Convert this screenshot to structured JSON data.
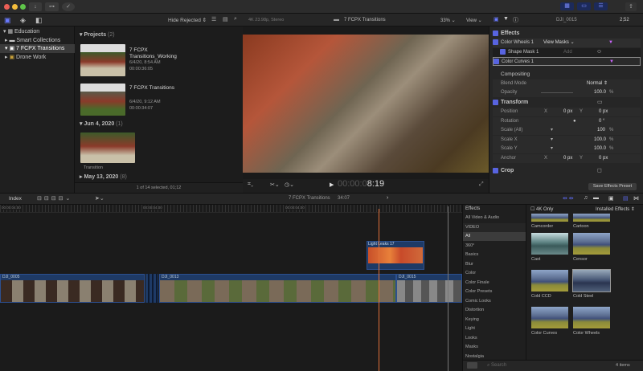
{
  "toolbar": {
    "import": "↓",
    "keywords": "⊶",
    "bg_tasks": "✓"
  },
  "browser_header": {
    "filter": "Hide Rejected"
  },
  "sidebar": {
    "items": [
      {
        "label": "Education",
        "icon": "library-icon"
      },
      {
        "label": "Smart Collections",
        "icon": "folder-icon"
      },
      {
        "label": "7 FCPX Transitions",
        "icon": "event-icon"
      },
      {
        "label": "Drone Work",
        "icon": "event-icon"
      }
    ]
  },
  "browser": {
    "projects_heading": "Projects",
    "projects_count": "(2)",
    "projects": [
      {
        "title": "7 FCPX Transitions_Working",
        "date": "6/4/20, 8:54 AM",
        "duration": "00:00:36:05"
      },
      {
        "title": "7 FCPX Transitions",
        "date": "6/4/20, 9:12 AM",
        "duration": "00:00:34:07"
      }
    ],
    "group1": "Jun 4, 2020",
    "group1_count": "(1)",
    "clip_label": "Transition",
    "group2": "May 13, 2020",
    "group2_count": "(8)",
    "status": "1 of 14 selected, 01;12"
  },
  "viewer": {
    "format": "4K 23.98p, Stereo",
    "title": "7 FCPX Transitions",
    "zoom": "33%",
    "view": "View",
    "timecode_dim": "00:00:0",
    "timecode": "8:19"
  },
  "inspector": {
    "clip": "DJI_0015",
    "timecode": "2;52",
    "effects_heading": "Effects",
    "color_wheels": "Color Wheels 1",
    "view_masks": "View Masks",
    "shape_mask": "Shape Mask 1",
    "add": "Add",
    "color_curves": "Color Curves 1",
    "compositing": "Compositing",
    "blend_mode": "Blend Mode",
    "blend_value": "Normal",
    "opacity": "Opacity",
    "opacity_value": "100.0",
    "pct": "%",
    "transform": "Transform",
    "position": "Position",
    "rotation": "Rotation",
    "rotation_value": "0 °",
    "scale_all": "Scale (All)",
    "scale_all_value": "100",
    "scale_x": "Scale X",
    "scale_x_value": "100.0",
    "scale_y": "Scale Y",
    "scale_y_value": "100.0",
    "anchor": "Anchor",
    "x": "X",
    "y": "Y",
    "zero_px": "0 px",
    "crop": "Crop",
    "save_preset": "Save Effects Preset"
  },
  "timeline": {
    "index": "Index",
    "project": "7 FCPX Transitions",
    "duration": "34:07",
    "ruler": [
      "00:00:04:00",
      "00:00:04:00",
      "00:00:04:00"
    ],
    "clips": [
      {
        "name": "DJI_0005"
      },
      {
        "name": "DJI_0013"
      },
      {
        "name": "DJI_0015"
      }
    ],
    "connected_clip": "Light Leaks 17"
  },
  "effects_browser": {
    "heading": "Effects",
    "four_k": "4K Only",
    "installed": "Installed Effects",
    "categories": [
      "All Video & Audio",
      "VIDEO",
      "All",
      "360°",
      "Basics",
      "Blur",
      "Color",
      "Color Finale",
      "Color Presets",
      "Comic Looks",
      "Distortion",
      "Keying",
      "Light",
      "Looks",
      "Masks",
      "Nostalgia"
    ],
    "items": [
      "Camcorder",
      "Cartoon",
      "Cast",
      "Censor",
      "Cold CCD",
      "Cold Steel",
      "Color Curves",
      "Color Wheels"
    ],
    "search_placeholder": "Search",
    "count": "4 items"
  },
  "colors": {
    "accent": "#5864e0",
    "playhead": "#e0703a",
    "clip": "#1e3a66"
  }
}
